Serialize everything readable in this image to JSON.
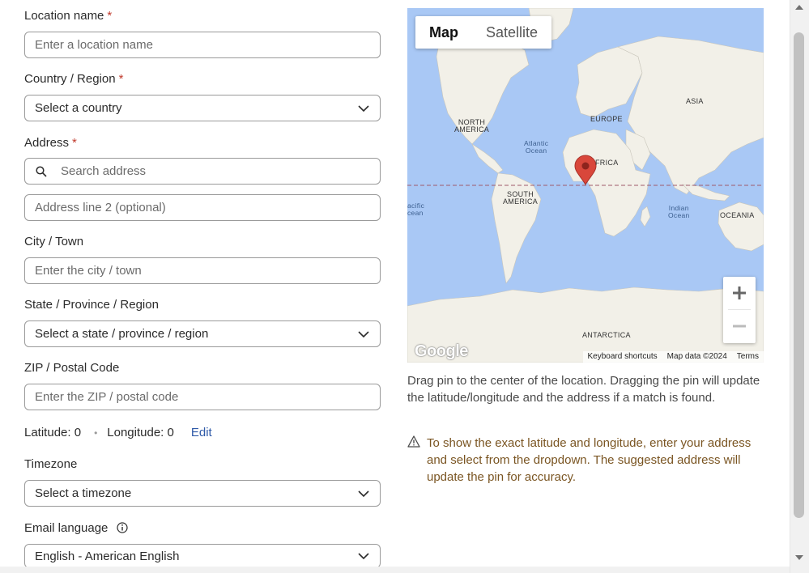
{
  "form": {
    "location_name": {
      "label": "Location name",
      "required_mark": "*",
      "placeholder": "Enter a location name"
    },
    "country": {
      "label": "Country / Region",
      "required_mark": "*",
      "value": "Select a country"
    },
    "address": {
      "label": "Address",
      "required_mark": "*",
      "search_placeholder": "Search address",
      "line2_placeholder": "Address line 2 (optional)"
    },
    "city": {
      "label": "City / Town",
      "placeholder": "Enter the city / town"
    },
    "state": {
      "label": "State / Province / Region",
      "value": "Select a state / province / region"
    },
    "zip": {
      "label": "ZIP / Postal Code",
      "placeholder": "Enter the ZIP / postal code"
    },
    "coords": {
      "latitude": "Latitude: 0",
      "separator": "•",
      "longitude": "Longitude: 0",
      "edit": "Edit"
    },
    "timezone": {
      "label": "Timezone",
      "value": "Select a timezone"
    },
    "email_language": {
      "label": "Email language",
      "value": "English - American English"
    }
  },
  "map": {
    "tabs": [
      "Map",
      "Satellite"
    ],
    "active_tab": "Map",
    "labels": {
      "north_america": [
        "NORTH",
        "AMERICA"
      ],
      "south_america": [
        "SOUTH",
        "AMERICA"
      ],
      "europe": "EUROPE",
      "asia": "ASIA",
      "africa": "FRICA",
      "oceania": "OCEANIA",
      "antarctica": "ANTARCTICA",
      "atlantic": [
        "Atlantic",
        "Ocean"
      ],
      "indian": [
        "Indian",
        "Ocean"
      ],
      "pacific": [
        "acific",
        "cean"
      ]
    },
    "logo": "Google",
    "footer": {
      "shortcuts": "Keyboard shortcuts",
      "map_data": "Map data ©2024",
      "terms": "Terms"
    },
    "zoom_in": "+",
    "zoom_out": "−"
  },
  "help_text": "Drag pin to the center of the location. Dragging the pin will update the latitude/longitude and the address if a match is found.",
  "warning_text": "To show the exact latitude and longitude, enter your address and select from the dropdown. The suggested address will update the pin for accuracy.",
  "colors": {
    "water": "#a9c8f5",
    "land": "#f2f0e8",
    "pin": "#d9473b",
    "required": "#c0392b",
    "link": "#2f5aa8",
    "warning_text": "#7a5522"
  },
  "icons": {
    "search": "search-icon",
    "chevron": "chevron-down-icon",
    "info": "info-icon",
    "warning": "warning-icon",
    "pin": "map-pin-icon"
  }
}
